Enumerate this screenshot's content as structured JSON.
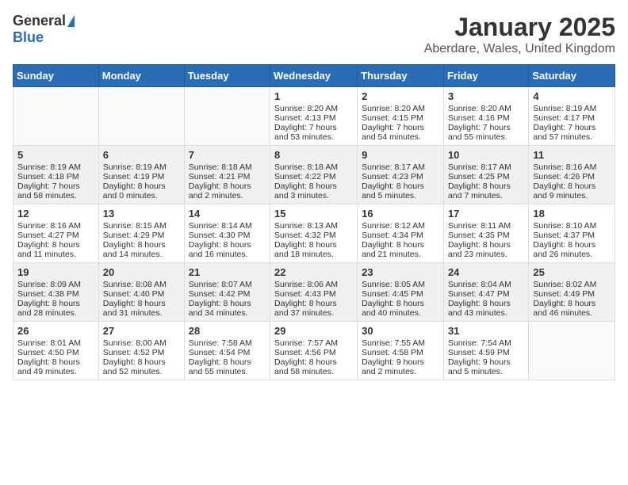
{
  "logo": {
    "general": "General",
    "blue": "Blue"
  },
  "title": "January 2025",
  "subtitle": "Aberdare, Wales, United Kingdom",
  "weekdays": [
    "Sunday",
    "Monday",
    "Tuesday",
    "Wednesday",
    "Thursday",
    "Friday",
    "Saturday"
  ],
  "weeks": [
    {
      "shaded": false,
      "days": [
        {
          "num": "",
          "lines": []
        },
        {
          "num": "",
          "lines": []
        },
        {
          "num": "",
          "lines": []
        },
        {
          "num": "1",
          "lines": [
            "Sunrise: 8:20 AM",
            "Sunset: 4:13 PM",
            "Daylight: 7 hours",
            "and 53 minutes."
          ]
        },
        {
          "num": "2",
          "lines": [
            "Sunrise: 8:20 AM",
            "Sunset: 4:15 PM",
            "Daylight: 7 hours",
            "and 54 minutes."
          ]
        },
        {
          "num": "3",
          "lines": [
            "Sunrise: 8:20 AM",
            "Sunset: 4:16 PM",
            "Daylight: 7 hours",
            "and 55 minutes."
          ]
        },
        {
          "num": "4",
          "lines": [
            "Sunrise: 8:19 AM",
            "Sunset: 4:17 PM",
            "Daylight: 7 hours",
            "and 57 minutes."
          ]
        }
      ]
    },
    {
      "shaded": true,
      "days": [
        {
          "num": "5",
          "lines": [
            "Sunrise: 8:19 AM",
            "Sunset: 4:18 PM",
            "Daylight: 7 hours",
            "and 58 minutes."
          ]
        },
        {
          "num": "6",
          "lines": [
            "Sunrise: 8:19 AM",
            "Sunset: 4:19 PM",
            "Daylight: 8 hours",
            "and 0 minutes."
          ]
        },
        {
          "num": "7",
          "lines": [
            "Sunrise: 8:18 AM",
            "Sunset: 4:21 PM",
            "Daylight: 8 hours",
            "and 2 minutes."
          ]
        },
        {
          "num": "8",
          "lines": [
            "Sunrise: 8:18 AM",
            "Sunset: 4:22 PM",
            "Daylight: 8 hours",
            "and 3 minutes."
          ]
        },
        {
          "num": "9",
          "lines": [
            "Sunrise: 8:17 AM",
            "Sunset: 4:23 PM",
            "Daylight: 8 hours",
            "and 5 minutes."
          ]
        },
        {
          "num": "10",
          "lines": [
            "Sunrise: 8:17 AM",
            "Sunset: 4:25 PM",
            "Daylight: 8 hours",
            "and 7 minutes."
          ]
        },
        {
          "num": "11",
          "lines": [
            "Sunrise: 8:16 AM",
            "Sunset: 4:26 PM",
            "Daylight: 8 hours",
            "and 9 minutes."
          ]
        }
      ]
    },
    {
      "shaded": false,
      "days": [
        {
          "num": "12",
          "lines": [
            "Sunrise: 8:16 AM",
            "Sunset: 4:27 PM",
            "Daylight: 8 hours",
            "and 11 minutes."
          ]
        },
        {
          "num": "13",
          "lines": [
            "Sunrise: 8:15 AM",
            "Sunset: 4:29 PM",
            "Daylight: 8 hours",
            "and 14 minutes."
          ]
        },
        {
          "num": "14",
          "lines": [
            "Sunrise: 8:14 AM",
            "Sunset: 4:30 PM",
            "Daylight: 8 hours",
            "and 16 minutes."
          ]
        },
        {
          "num": "15",
          "lines": [
            "Sunrise: 8:13 AM",
            "Sunset: 4:32 PM",
            "Daylight: 8 hours",
            "and 18 minutes."
          ]
        },
        {
          "num": "16",
          "lines": [
            "Sunrise: 8:12 AM",
            "Sunset: 4:34 PM",
            "Daylight: 8 hours",
            "and 21 minutes."
          ]
        },
        {
          "num": "17",
          "lines": [
            "Sunrise: 8:11 AM",
            "Sunset: 4:35 PM",
            "Daylight: 8 hours",
            "and 23 minutes."
          ]
        },
        {
          "num": "18",
          "lines": [
            "Sunrise: 8:10 AM",
            "Sunset: 4:37 PM",
            "Daylight: 8 hours",
            "and 26 minutes."
          ]
        }
      ]
    },
    {
      "shaded": true,
      "days": [
        {
          "num": "19",
          "lines": [
            "Sunrise: 8:09 AM",
            "Sunset: 4:38 PM",
            "Daylight: 8 hours",
            "and 28 minutes."
          ]
        },
        {
          "num": "20",
          "lines": [
            "Sunrise: 8:08 AM",
            "Sunset: 4:40 PM",
            "Daylight: 8 hours",
            "and 31 minutes."
          ]
        },
        {
          "num": "21",
          "lines": [
            "Sunrise: 8:07 AM",
            "Sunset: 4:42 PM",
            "Daylight: 8 hours",
            "and 34 minutes."
          ]
        },
        {
          "num": "22",
          "lines": [
            "Sunrise: 8:06 AM",
            "Sunset: 4:43 PM",
            "Daylight: 8 hours",
            "and 37 minutes."
          ]
        },
        {
          "num": "23",
          "lines": [
            "Sunrise: 8:05 AM",
            "Sunset: 4:45 PM",
            "Daylight: 8 hours",
            "and 40 minutes."
          ]
        },
        {
          "num": "24",
          "lines": [
            "Sunrise: 8:04 AM",
            "Sunset: 4:47 PM",
            "Daylight: 8 hours",
            "and 43 minutes."
          ]
        },
        {
          "num": "25",
          "lines": [
            "Sunrise: 8:02 AM",
            "Sunset: 4:49 PM",
            "Daylight: 8 hours",
            "and 46 minutes."
          ]
        }
      ]
    },
    {
      "shaded": false,
      "days": [
        {
          "num": "26",
          "lines": [
            "Sunrise: 8:01 AM",
            "Sunset: 4:50 PM",
            "Daylight: 8 hours",
            "and 49 minutes."
          ]
        },
        {
          "num": "27",
          "lines": [
            "Sunrise: 8:00 AM",
            "Sunset: 4:52 PM",
            "Daylight: 8 hours",
            "and 52 minutes."
          ]
        },
        {
          "num": "28",
          "lines": [
            "Sunrise: 7:58 AM",
            "Sunset: 4:54 PM",
            "Daylight: 8 hours",
            "and 55 minutes."
          ]
        },
        {
          "num": "29",
          "lines": [
            "Sunrise: 7:57 AM",
            "Sunset: 4:56 PM",
            "Daylight: 8 hours",
            "and 58 minutes."
          ]
        },
        {
          "num": "30",
          "lines": [
            "Sunrise: 7:55 AM",
            "Sunset: 4:58 PM",
            "Daylight: 9 hours",
            "and 2 minutes."
          ]
        },
        {
          "num": "31",
          "lines": [
            "Sunrise: 7:54 AM",
            "Sunset: 4:59 PM",
            "Daylight: 9 hours",
            "and 5 minutes."
          ]
        },
        {
          "num": "",
          "lines": []
        }
      ]
    }
  ]
}
